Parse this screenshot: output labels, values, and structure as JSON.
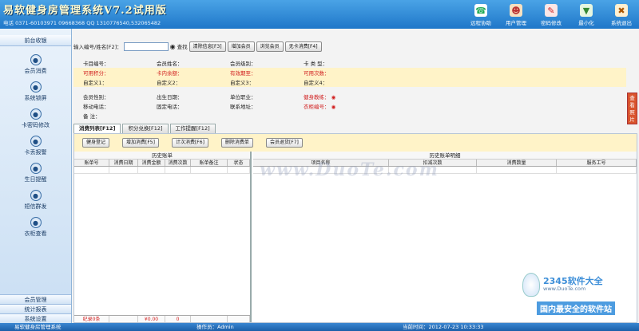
{
  "header": {
    "title": "易软健身房管理系统V7.2试用版",
    "contact": "电话 0371-60103971  09668368 QQ 1310776540,532065482",
    "tools": [
      {
        "label": "远程协助",
        "icon": "remote-assist-icon",
        "color": "#f2f2f2"
      },
      {
        "label": "用户管理",
        "icon": "user-manage-icon",
        "color": "#f2f2f2"
      },
      {
        "label": "密码修改",
        "icon": "password-edit-icon",
        "color": "#f2f2f2"
      },
      {
        "label": "最小化",
        "icon": "minimize-icon",
        "color": "#f2f2f2"
      },
      {
        "label": "系统退出",
        "icon": "exit-icon",
        "color": "#f2f2f2"
      }
    ]
  },
  "sidebar": {
    "heading": "前台收银",
    "items": [
      {
        "label": "会员消费",
        "icon": "member-consume-icon"
      },
      {
        "label": "系统锁屏",
        "icon": "lock-screen-icon"
      },
      {
        "label": "卡密码修改",
        "icon": "card-password-icon"
      },
      {
        "label": "卡丢报警",
        "icon": "card-lost-icon"
      },
      {
        "label": "生日提醒",
        "icon": "birthday-icon"
      },
      {
        "label": "短信群发",
        "icon": "sms-icon"
      },
      {
        "label": "衣柜查看",
        "icon": "wardrobe-icon"
      }
    ],
    "bottom": [
      "会员管理",
      "统计报表",
      "系统设置"
    ]
  },
  "search": {
    "label": "输入编号/姓名[F2]：",
    "value": "",
    "find_label": "查找",
    "buttons": [
      "清除信息[F3]",
      "增加会员",
      "浏览会员",
      "无卡消费[F4]"
    ]
  },
  "info": {
    "row1": [
      "卡目编号：",
      "会员姓名：",
      "会员级别：",
      "卡 类 型："
    ],
    "row2": [
      "可用积分：",
      "卡内余额：",
      "有效期至：",
      "可用次数："
    ],
    "row3": [
      "自定义1：",
      "自定义2：",
      "自定义3：",
      "自定义4："
    ],
    "row4": [
      "会员性别：",
      "出生日期：",
      "单位职业：",
      "健身教练："
    ],
    "row5": [
      "移动电话：",
      "固定电话：",
      "联系地址：",
      "衣柜编号："
    ],
    "row6": [
      "备    注："
    ],
    "view_photo": "查看照片"
  },
  "tabs": [
    "消费列表[F12]",
    "积分兑换[F12]",
    "工作提醒[F12]"
  ],
  "actions": [
    "健身登记",
    "增加消费[F5]",
    "计次消费[F6]",
    "删除消费单",
    "会员退货[F7]"
  ],
  "left_grid": {
    "title": "历史账单",
    "columns": [
      "账单号",
      "消费日期",
      "消费金额",
      "消费次数",
      "账单备注",
      "状态"
    ],
    "footer": [
      "纪录0条",
      "",
      "¥0.00",
      "0",
      "",
      ""
    ]
  },
  "right_grid": {
    "title": "历史账单明细",
    "columns": [
      "项目名称",
      "扣减次数",
      "消费数量",
      "服务工号"
    ]
  },
  "watermark": "www.DuoTe.com",
  "badge": {
    "name": "2345软件大全",
    "url": "www.DuoTe.com",
    "slogan": "国内最安全的软件站"
  },
  "status": {
    "app": "易软健身房管理系统",
    "operator": "操作员：Admin",
    "time": "当前时间：2012-07-23 10:33:33"
  }
}
